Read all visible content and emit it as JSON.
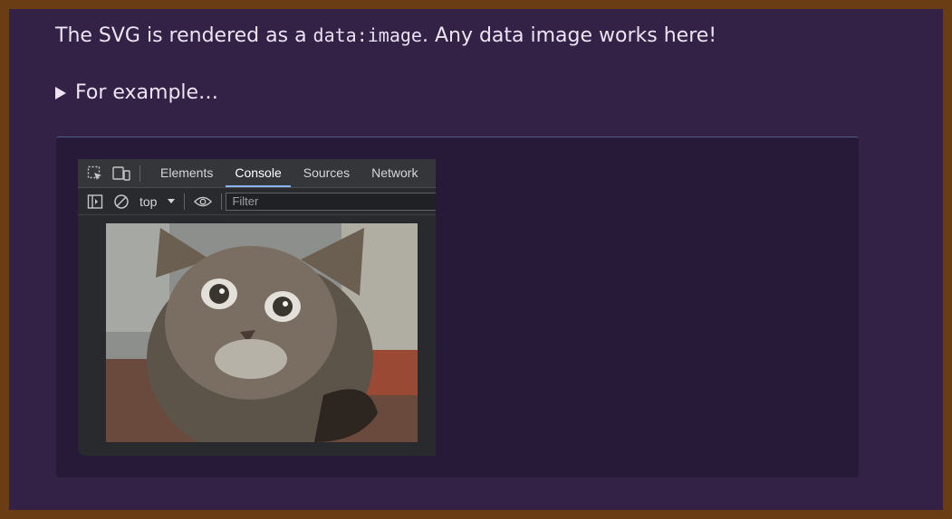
{
  "intro": {
    "before": "The SVG is rendered as a ",
    "code": "data:image",
    "after": ". Any data image works here!"
  },
  "details": {
    "summary": "For example…"
  },
  "devtools": {
    "tabs": [
      "Elements",
      "Console",
      "Sources",
      "Network"
    ],
    "active_tab": "Console",
    "context": "top",
    "filter_placeholder": "Filter"
  },
  "image": {
    "subject": "kitten photo"
  },
  "colors": {
    "page_bg": "#332146",
    "panel_bg": "#271a38",
    "border": "#6b3d14",
    "text": "#ece4f2",
    "devtools_bg": "#292a2d",
    "tab_indicator": "#8ab4f8"
  }
}
